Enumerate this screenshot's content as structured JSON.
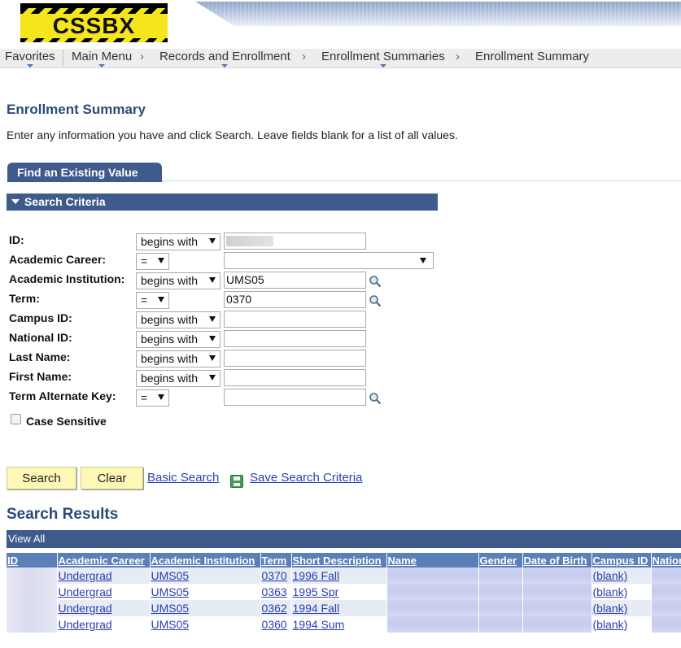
{
  "header": {
    "logo_text": "CSSBX"
  },
  "nav": {
    "favorites": "Favorites",
    "main_menu": "Main Menu",
    "sep": "›",
    "records": "Records and Enrollment",
    "enrollment_summaries": "Enrollment Summaries",
    "enrollment_summary": "Enrollment Summary"
  },
  "page": {
    "title": "Enrollment Summary",
    "instructions": "Enter any information you have and click Search. Leave fields blank for a list of all values."
  },
  "tab": {
    "label": "Find an Existing Value"
  },
  "criteria": {
    "header": "Search Criteria",
    "fields": {
      "id": {
        "label": "ID:",
        "op": "begins with",
        "value": ""
      },
      "career": {
        "label": "Academic Career:",
        "op": "=",
        "value": ""
      },
      "institution": {
        "label": "Academic Institution:",
        "op": "begins with",
        "value": "UMS05"
      },
      "term": {
        "label": "Term:",
        "op": "=",
        "value": "0370"
      },
      "campus": {
        "label": "Campus ID:",
        "op": "begins with",
        "value": ""
      },
      "national": {
        "label": "National ID:",
        "op": "begins with",
        "value": ""
      },
      "last": {
        "label": "Last Name:",
        "op": "begins with",
        "value": ""
      },
      "first": {
        "label": "First Name:",
        "op": "begins with",
        "value": ""
      },
      "alt": {
        "label": "Term Alternate Key:",
        "op": "=",
        "value": ""
      }
    },
    "case_sensitive": "Case Sensitive"
  },
  "actions": {
    "search": "Search",
    "clear": "Clear",
    "basic_search": "Basic Search",
    "save_criteria": "Save Search Criteria"
  },
  "results": {
    "title": "Search Results",
    "view_all": "View All",
    "columns": [
      "ID",
      "Academic Career",
      "Academic Institution",
      "Term",
      "Short Description",
      "Name",
      "Gender",
      "Date of Birth",
      "Campus ID",
      "National ID"
    ],
    "rows": [
      {
        "career": "Undergrad",
        "institution": "UMS05",
        "term": "0370",
        "desc": "1996 Fall",
        "campus": "(blank)"
      },
      {
        "career": "Undergrad",
        "institution": "UMS05",
        "term": "0363",
        "desc": "1995 Spr",
        "campus": "(blank)"
      },
      {
        "career": "Undergrad",
        "institution": "UMS05",
        "term": "0362",
        "desc": "1994 Fall",
        "campus": "(blank)"
      },
      {
        "career": "Undergrad",
        "institution": "UMS05",
        "term": "0360",
        "desc": "1994 Sum",
        "campus": "(blank)"
      }
    ]
  },
  "colors": {
    "brand_navy": "#3e5b8c",
    "grid_header": "#5b7fb8",
    "button_yellow": "#fdf8b6",
    "link": "#2a3fb0"
  }
}
